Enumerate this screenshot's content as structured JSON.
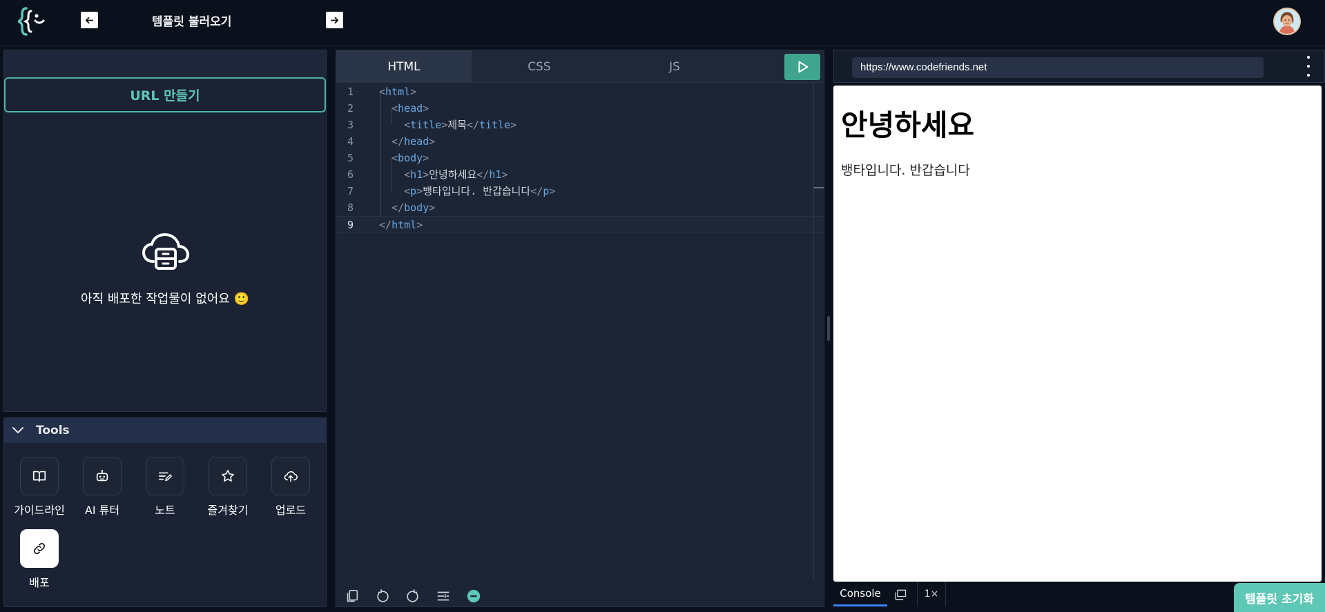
{
  "header": {
    "back_label": "←",
    "title": "템플릿 불러오기",
    "forward_label": "→"
  },
  "left": {
    "make_url_label": "URL 만들기",
    "empty_message": "아직 배포한 작업물이 없어요 🙂"
  },
  "tools": {
    "title": "Tools",
    "items": [
      {
        "label": "가이드라인",
        "icon": "book-icon"
      },
      {
        "label": "AI 튜터",
        "icon": "robot-icon"
      },
      {
        "label": "노트",
        "icon": "note-edit-icon"
      },
      {
        "label": "즐겨찾기",
        "icon": "star-icon"
      },
      {
        "label": "업로드",
        "icon": "cloud-upload-icon"
      },
      {
        "label": "배포",
        "icon": "link-icon"
      }
    ]
  },
  "editor": {
    "tabs": [
      "HTML",
      "CSS",
      "JS"
    ],
    "active_tab": "HTML",
    "current_line": 9,
    "lines": [
      {
        "n": "1",
        "indent": "",
        "parts": [
          [
            "br",
            "<"
          ],
          [
            "tg",
            "html"
          ],
          [
            "br",
            ">"
          ]
        ]
      },
      {
        "n": "2",
        "indent": "  ",
        "parts": [
          [
            "br",
            "<"
          ],
          [
            "tg",
            "head"
          ],
          [
            "br",
            ">"
          ]
        ]
      },
      {
        "n": "3",
        "indent": "    ",
        "parts": [
          [
            "br",
            "<"
          ],
          [
            "tg",
            "title"
          ],
          [
            "br",
            ">"
          ],
          [
            "tx",
            "제목"
          ],
          [
            "br",
            "</"
          ],
          [
            "tg",
            "title"
          ],
          [
            "br",
            ">"
          ]
        ]
      },
      {
        "n": "4",
        "indent": "  ",
        "parts": [
          [
            "br",
            "</"
          ],
          [
            "tg",
            "head"
          ],
          [
            "br",
            ">"
          ]
        ]
      },
      {
        "n": "5",
        "indent": "  ",
        "parts": [
          [
            "br",
            "<"
          ],
          [
            "tg",
            "body"
          ],
          [
            "br",
            ">"
          ]
        ]
      },
      {
        "n": "6",
        "indent": "    ",
        "parts": [
          [
            "br",
            "<"
          ],
          [
            "tg",
            "h1"
          ],
          [
            "br",
            ">"
          ],
          [
            "tx",
            "안녕하세요"
          ],
          [
            "br",
            "</"
          ],
          [
            "tg",
            "h1"
          ],
          [
            "br",
            ">"
          ]
        ]
      },
      {
        "n": "7",
        "indent": "    ",
        "parts": [
          [
            "br",
            "<"
          ],
          [
            "tg",
            "p"
          ],
          [
            "br",
            ">"
          ],
          [
            "tx",
            "뱅타입니다. 반갑습니다"
          ],
          [
            "br",
            "</"
          ],
          [
            "tg",
            "p"
          ],
          [
            "br",
            ">"
          ]
        ]
      },
      {
        "n": "8",
        "indent": "  ",
        "parts": [
          [
            "br",
            "</"
          ],
          [
            "tg",
            "body"
          ],
          [
            "br",
            ">"
          ]
        ]
      },
      {
        "n": "9",
        "indent": "",
        "parts": [
          [
            "br",
            "</"
          ],
          [
            "tg",
            "html"
          ],
          [
            "br",
            ">"
          ]
        ]
      }
    ]
  },
  "browser": {
    "url": "https://www.codefriends.net",
    "heading": "안녕하세요",
    "paragraph": "뱅타입니다. 반갑습니다"
  },
  "console": {
    "tab_label": "Console",
    "zoom": "1×"
  },
  "reset_label": "템플릿 초기화",
  "colors": {
    "accent": "#5ec7b6",
    "run": "#3fa58f",
    "background": "#0b111c",
    "panel": "#1a2233"
  }
}
